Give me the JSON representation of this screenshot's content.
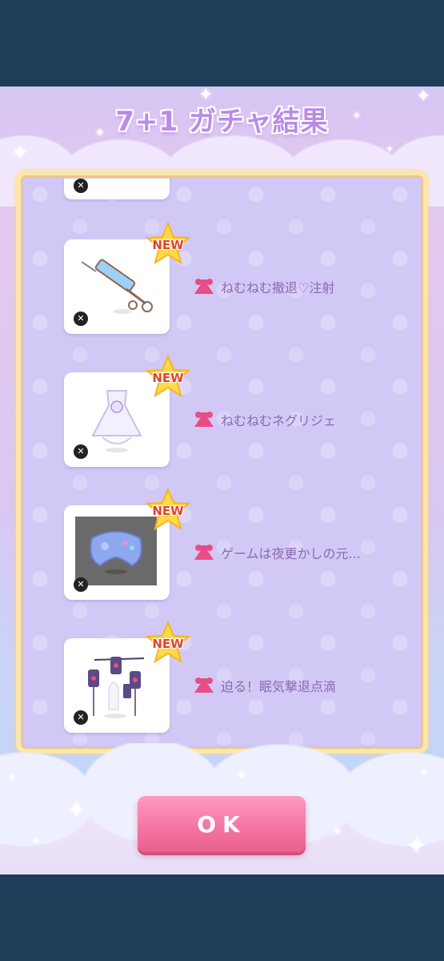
{
  "dialog": {
    "title": "7+1 ガチャ結果",
    "ok_label": "OK"
  },
  "badge_text": "NEW",
  "items": [
    {
      "name": "ねむねむ撤退♡注射",
      "is_new": true,
      "icon": "syringe-icon"
    },
    {
      "name": "ねむねむネグリジェ",
      "is_new": true,
      "icon": "nightgown-icon"
    },
    {
      "name": "ゲームは夜更かしの元...",
      "is_new": true,
      "icon": "game-controller-icon"
    },
    {
      "name": "迫る！眠気撃退点滴",
      "is_new": true,
      "icon": "iv-drip-icon"
    }
  ],
  "colors": {
    "background": "#1e3d58",
    "title": "#b98be6",
    "panel_border": "#fbe7a9",
    "label": "#8a6ab0",
    "ok_button": "#f3739f",
    "new_badge_text": "#e0432f"
  }
}
